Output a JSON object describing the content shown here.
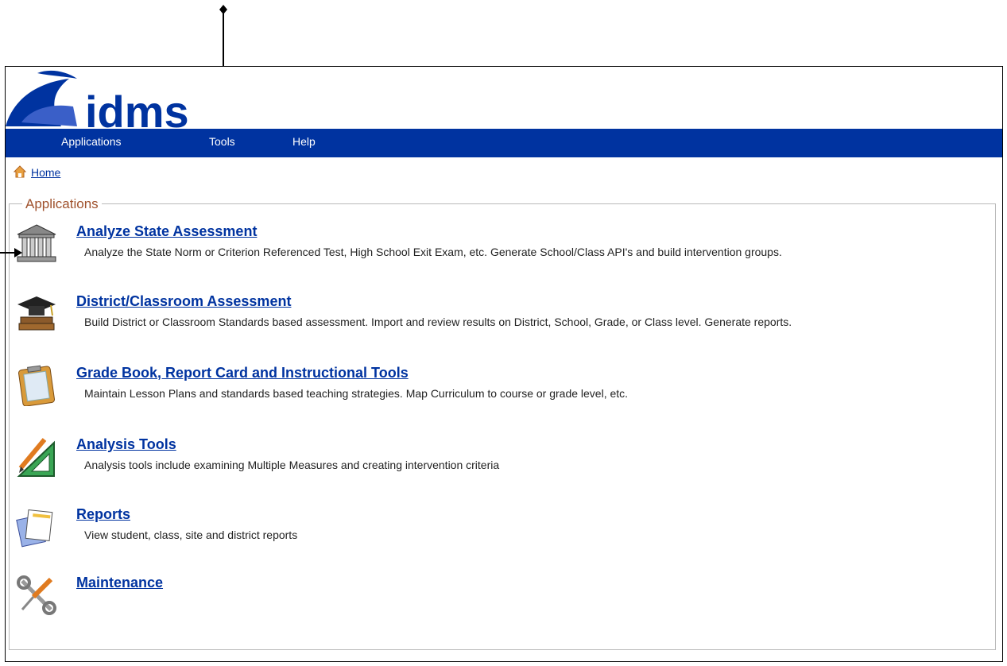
{
  "header": {
    "logo_text": "idms"
  },
  "nav": {
    "items": [
      "Applications",
      "Tools",
      "Help"
    ]
  },
  "breadcrumb": {
    "home_label": "Home"
  },
  "applications_section": {
    "legend": "Applications",
    "apps": [
      {
        "title": "Analyze State Assessment",
        "description": "Analyze the State Norm or Criterion Referenced Test, High School Exit Exam, etc. Generate School/Class API's and build intervention groups.",
        "icon": "courthouse-icon"
      },
      {
        "title": "District/Classroom Assessment",
        "description": "Build District or Classroom Standards based assessment. Import and review results on District, School, Grade, or Class level. Generate reports.",
        "icon": "graduation-cap-books-icon"
      },
      {
        "title": "Grade Book, Report Card and Instructional Tools",
        "description": "Maintain Lesson Plans and standards based teaching strategies. Map Curriculum to course or grade level, etc.",
        "icon": "clipboard-icon"
      },
      {
        "title": "Analysis Tools",
        "description": "Analysis tools include examining Multiple Measures and creating intervention criteria",
        "icon": "pencil-triangle-icon"
      },
      {
        "title": "Reports",
        "description": "View student, class, site and district reports",
        "icon": "reports-documents-icon"
      },
      {
        "title": "Maintenance",
        "description": "",
        "icon": "wrench-screwdriver-icon"
      }
    ]
  },
  "colors": {
    "nav_bg": "#0033a0",
    "link": "#0033a0",
    "legend": "#a0522d"
  }
}
